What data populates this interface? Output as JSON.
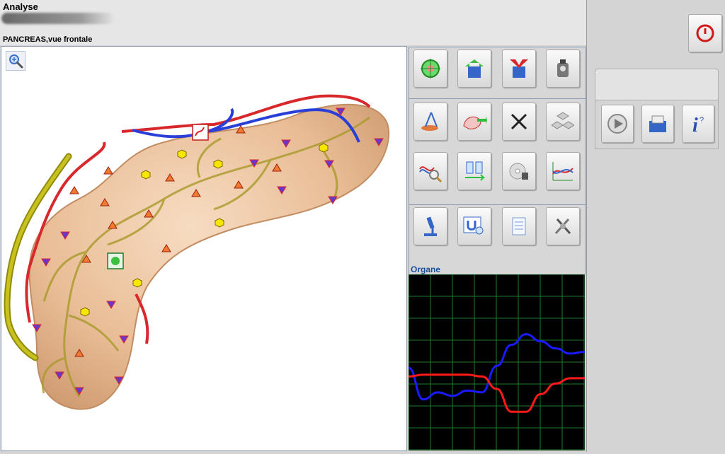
{
  "header": {
    "title": "Analyse",
    "subtitle": "PANCREAS,vue frontale"
  },
  "viewer": {
    "zoom_icon": "magnifier-zoom-icon",
    "organ_image": "pancreas-illustration",
    "markers": {
      "orange_triangle": "#f07a2e",
      "blue_triangle_down": "#6a35c8",
      "yellow_hexagon": "#f7e600"
    }
  },
  "toolbar": {
    "icons": [
      "target-scan-icon",
      "upload-box-icon",
      "download-box-icon",
      "robot-scanner-icon",
      "compass-organ-icon",
      "organ-arrow-icon",
      "close-x-icon",
      "cubes-icon",
      "wave-magnifier-icon",
      "vials-swap-icon",
      "disc-settings-icon",
      "line-chart-icon",
      "microscope-icon",
      "magnet-search-icon",
      "notes-icon",
      "tools-icon"
    ]
  },
  "chart_panel": {
    "label": "Organe"
  },
  "chart_data": {
    "type": "line",
    "x": [
      0,
      1,
      2,
      3,
      4,
      5,
      6,
      7,
      8,
      9,
      10,
      11,
      12
    ],
    "series": [
      {
        "values": [
          47,
          29,
          33,
          31,
          34,
          33,
          48,
          60,
          66,
          62,
          58,
          55,
          56
        ]
      },
      {
        "values": [
          42,
          43,
          43,
          43,
          43,
          42,
          35,
          22,
          22,
          32,
          38,
          41,
          41
        ]
      }
    ],
    "colors": [
      "#1a1aff",
      "#ff1a1a"
    ],
    "ylim": [
      0,
      100
    ],
    "grid": true,
    "grid_color": "#1e7a2a",
    "background": "#000000"
  },
  "right_panel": {
    "power_icon": "power-icon",
    "status_text": "",
    "buttons": [
      "play-icon",
      "archive-box-icon",
      "info-icon"
    ]
  }
}
